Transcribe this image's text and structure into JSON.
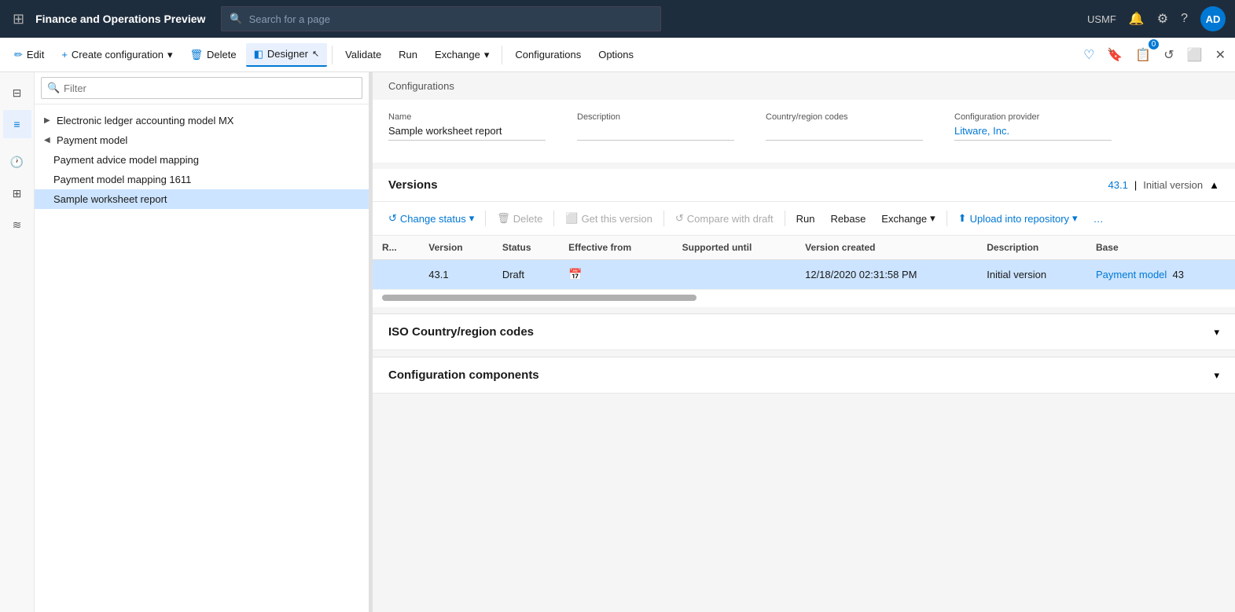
{
  "topBar": {
    "gridIcon": "⊞",
    "title": "Finance and Operations Preview",
    "searchPlaceholder": "Search for a page",
    "username": "USMF",
    "avatarText": "AD"
  },
  "toolbar": {
    "editLabel": "Edit",
    "createConfigLabel": "Create configuration",
    "deleteLabel": "Delete",
    "designerLabel": "Designer",
    "validateLabel": "Validate",
    "runLabel": "Run",
    "exchangeLabel": "Exchange",
    "configurationsLabel": "Configurations",
    "optionsLabel": "Options"
  },
  "breadcrumb": "Configurations",
  "form": {
    "nameLabel": "Name",
    "nameValue": "Sample worksheet report",
    "descriptionLabel": "Description",
    "descriptionValue": "",
    "countryLabel": "Country/region codes",
    "countryValue": "",
    "providerLabel": "Configuration provider",
    "providerValue": "Litware, Inc."
  },
  "versions": {
    "title": "Versions",
    "number": "43.1",
    "label": "Initial version",
    "toolbar": {
      "changeStatusLabel": "Change status",
      "deleteLabel": "Delete",
      "getVersionLabel": "Get this version",
      "compareLabel": "Compare with draft",
      "runLabel": "Run",
      "rebaseLabel": "Rebase",
      "exchangeLabel": "Exchange",
      "uploadLabel": "Upload into repository"
    },
    "tableHeaders": [
      "R...",
      "Version",
      "Status",
      "Effective from",
      "Supported until",
      "Version created",
      "Description",
      "Base"
    ],
    "rows": [
      {
        "r": "",
        "version": "43.1",
        "status": "Draft",
        "effectiveFrom": "",
        "supportedUntil": "",
        "versionCreated": "12/18/2020 02:31:58 PM",
        "description": "Initial version",
        "base": "Payment model",
        "baseNum": "43"
      }
    ]
  },
  "sidebar": {
    "filterPlaceholder": "Filter",
    "items": [
      {
        "label": "Electronic ledger accounting model MX",
        "level": 0,
        "expanded": false,
        "toggle": "▶"
      },
      {
        "label": "Payment model",
        "level": 0,
        "expanded": true,
        "toggle": "◀"
      },
      {
        "label": "Payment advice model mapping",
        "level": 1
      },
      {
        "label": "Payment model mapping 1611",
        "level": 1
      },
      {
        "label": "Sample worksheet report",
        "level": 1,
        "selected": true
      }
    ]
  },
  "collapsible": [
    {
      "title": "ISO Country/region codes"
    },
    {
      "title": "Configuration components"
    }
  ]
}
